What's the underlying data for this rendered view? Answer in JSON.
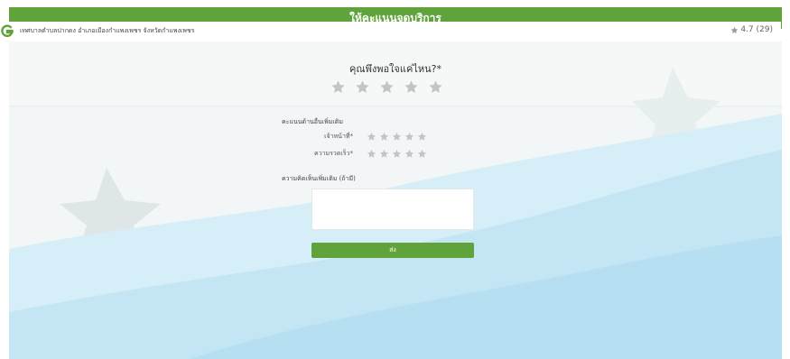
{
  "header": {
    "title": "ให้คะแนนจุดบริการ"
  },
  "place": {
    "name": "เทศบาลตำบลปากดง อำเภอเมืองกำแพงเพชร จังหวัดกำแพงเพชร",
    "rating_text": "4.7 (29)",
    "logo_icon": "g-logo-icon"
  },
  "question": {
    "title": "คุณพึงพอใจแค่ไหน?*",
    "stars_max": 5,
    "stars_selected": 0
  },
  "criteria": {
    "section_label": "คะแนนด้านอื่นเพิ่มเติม",
    "items": [
      {
        "label": "เจ้าหน้าที่*",
        "stars_max": 5,
        "stars_selected": 0
      },
      {
        "label": "ความรวดเร็ว*",
        "stars_max": 5,
        "stars_selected": 0
      }
    ]
  },
  "comment": {
    "label": "ความคิดเห็นเพิ่มเติม (ถ้ามี)",
    "value": "",
    "placeholder": ""
  },
  "submit": {
    "label": "ส่ง"
  },
  "colors": {
    "brand": "#5fa33a",
    "star_empty": "#c4c4c4",
    "wave_light": "#cdeaf6",
    "wave_mid": "#b4e0f2"
  }
}
